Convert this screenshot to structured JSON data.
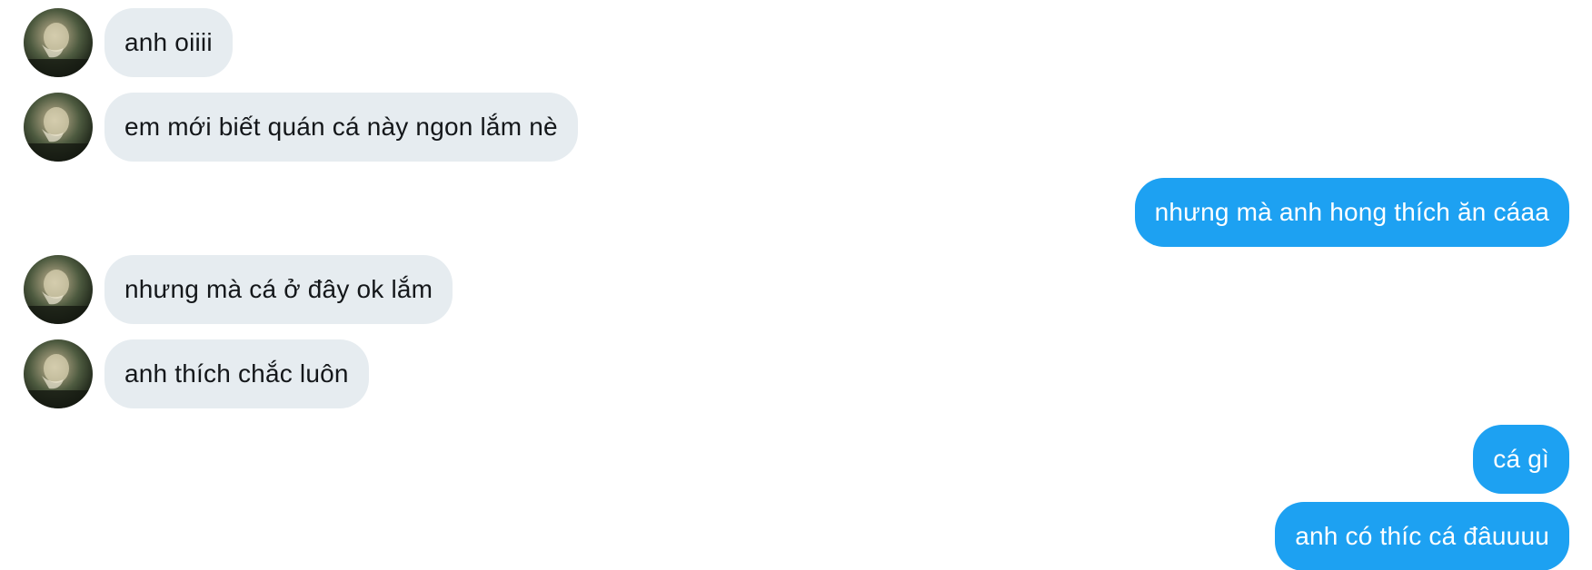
{
  "conversation": {
    "messages": [
      {
        "sender": "other",
        "text": "anh oiiii",
        "avatar_icon": "user-avatar-photo"
      },
      {
        "sender": "other",
        "text": "em mới biết quán cá này ngon lắm nè",
        "avatar_icon": "user-avatar-photo"
      },
      {
        "sender": "me",
        "text": "nhưng mà anh hong thích ăn cáaa"
      },
      {
        "sender": "other",
        "text": "nhưng mà cá ở đây ok lắm",
        "avatar_icon": "user-avatar-photo"
      },
      {
        "sender": "other",
        "text": "anh thích chắc luôn",
        "avatar_icon": "user-avatar-photo"
      },
      {
        "sender": "me",
        "text": "cá gì"
      },
      {
        "sender": "me",
        "text": "anh có thíc cá đâuuuu"
      }
    ]
  },
  "colors": {
    "incoming_bubble": "#e6ecf0",
    "outgoing_bubble": "#1da1f2",
    "incoming_text": "#14171a",
    "outgoing_text": "#ffffff"
  }
}
